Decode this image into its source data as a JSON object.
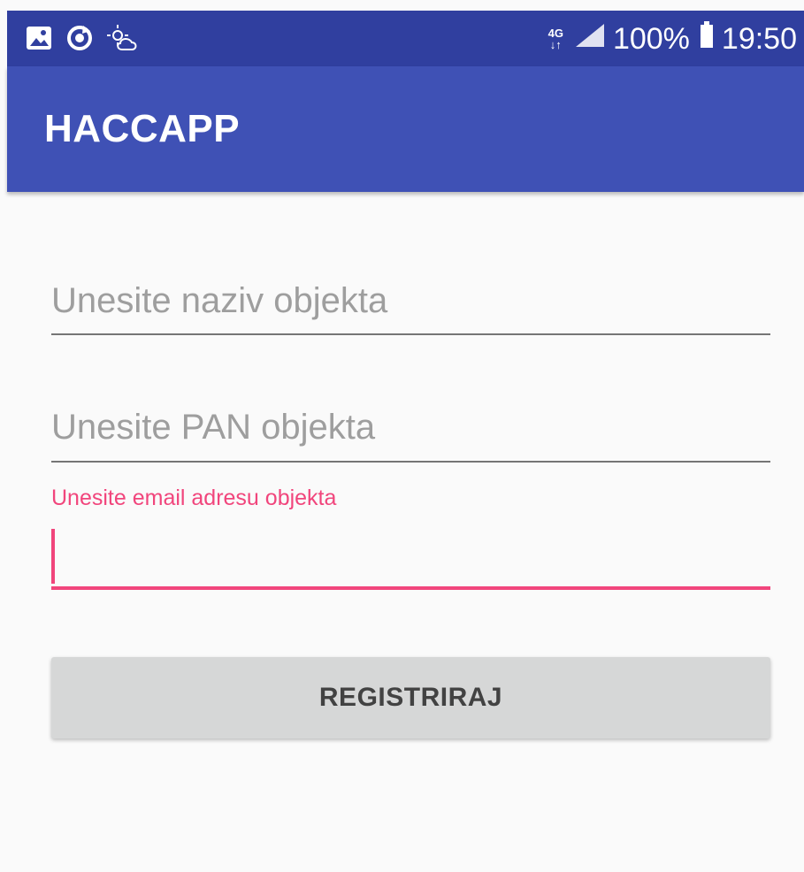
{
  "status_bar": {
    "left_icons": [
      "image-icon",
      "sync-icon",
      "weather-icon"
    ],
    "network": "4G",
    "battery": "100%",
    "time": "19:50",
    "colors": {
      "status_bg": "#303f9f",
      "icon_color": "#ffffff"
    }
  },
  "app_bar": {
    "title": "HACCAPP",
    "color": "#3f51b5"
  },
  "form": {
    "object_name": {
      "placeholder": "Unesite naziv objekta",
      "value": ""
    },
    "object_pan": {
      "placeholder": "Unesite PAN objekta",
      "value": ""
    },
    "email": {
      "label": "Unesite email adresu objekta",
      "value": "",
      "focus_color": "#f1457c"
    },
    "submit_label": "REGISTRIRAJ"
  }
}
